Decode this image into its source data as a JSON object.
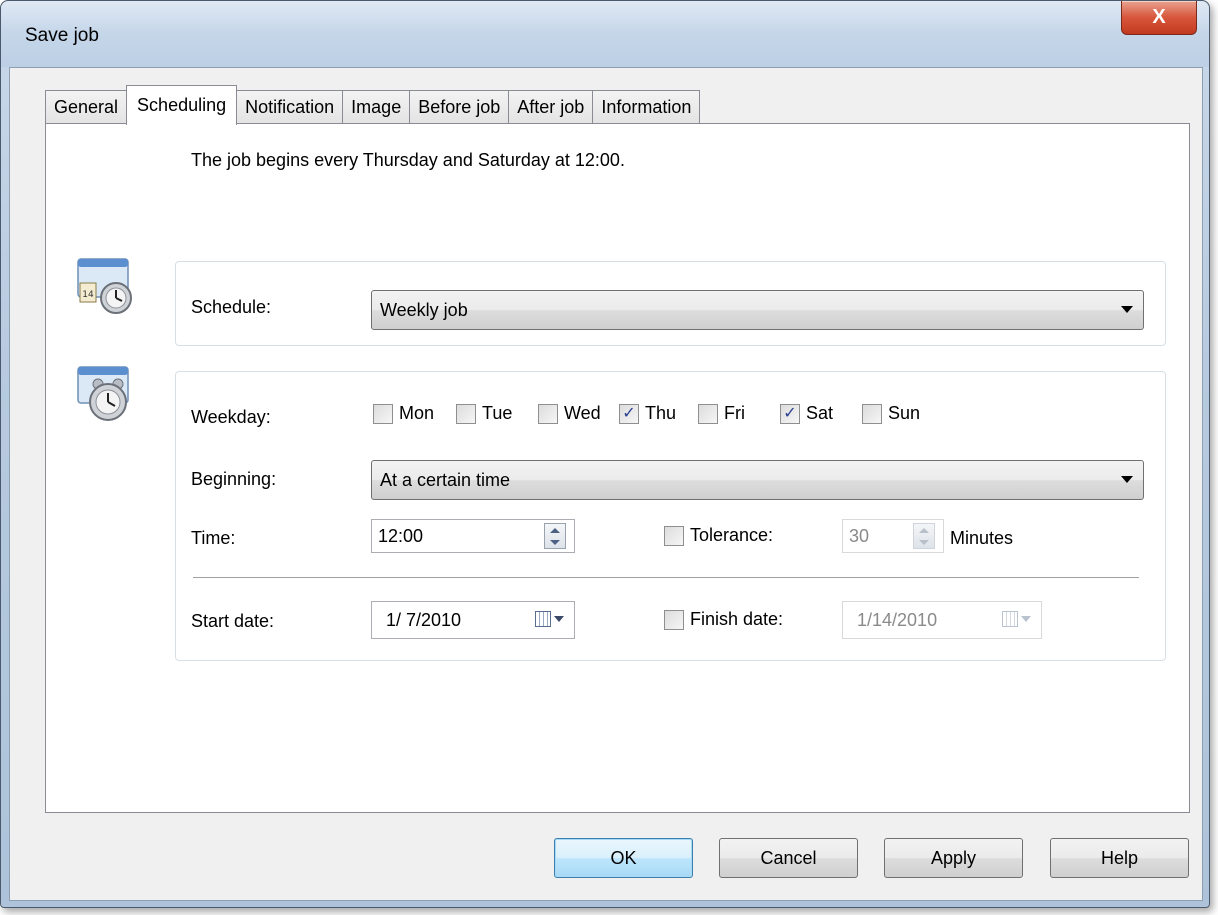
{
  "window": {
    "title": "Save job",
    "close_label": "X"
  },
  "tabs": [
    {
      "label": "General",
      "active": false
    },
    {
      "label": "Scheduling",
      "active": true
    },
    {
      "label": "Notification",
      "active": false
    },
    {
      "label": "Image",
      "active": false
    },
    {
      "label": "Before job",
      "active": false
    },
    {
      "label": "After job",
      "active": false
    },
    {
      "label": "Information",
      "active": false
    }
  ],
  "summary": "The job begins every Thursday and Saturday at 12:00.",
  "schedule": {
    "label": "Schedule:",
    "value": "Weekly job"
  },
  "weekday": {
    "label": "Weekday:",
    "days": [
      {
        "label": "Mon",
        "checked": false
      },
      {
        "label": "Tue",
        "checked": false
      },
      {
        "label": "Wed",
        "checked": false
      },
      {
        "label": "Thu",
        "checked": true
      },
      {
        "label": "Fri",
        "checked": false
      },
      {
        "label": "Sat",
        "checked": true
      },
      {
        "label": "Sun",
        "checked": false
      }
    ]
  },
  "beginning": {
    "label": "Beginning:",
    "value": "At a certain time"
  },
  "time": {
    "label": "Time:",
    "value": "12:00"
  },
  "tolerance": {
    "label": "Tolerance:",
    "checked": false,
    "value": "30",
    "unit": "Minutes"
  },
  "start_date": {
    "label": "Start date:",
    "value": "1/ 7/2010"
  },
  "finish_date": {
    "label": "Finish date:",
    "checked": false,
    "value": "1/14/2010"
  },
  "buttons": {
    "ok": "OK",
    "cancel": "Cancel",
    "apply": "Apply",
    "help": "Help"
  },
  "icons": {
    "schedule": "calendar-clock-icon",
    "weekday": "alarm-clock-icon",
    "check_mark": "✓"
  }
}
